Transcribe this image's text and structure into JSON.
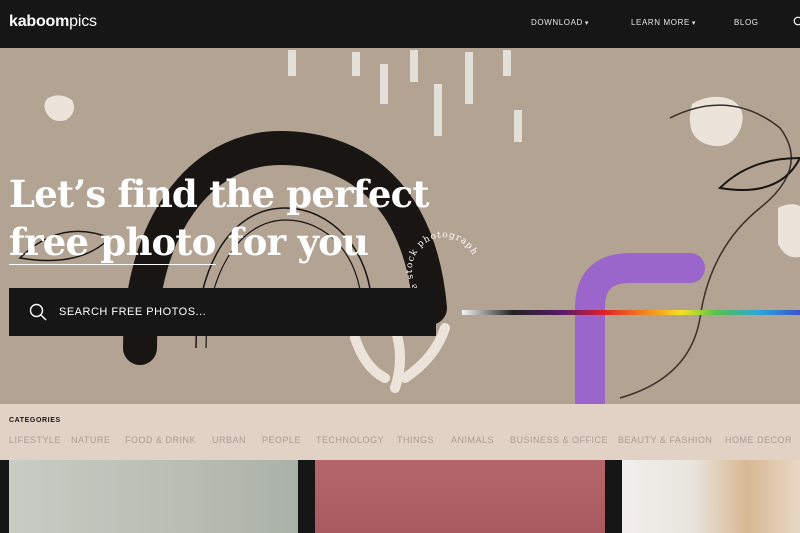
{
  "header": {
    "logo_bold": "kaboom",
    "logo_light": "pics",
    "nav": [
      {
        "label": "DOWNLOAD",
        "has_caret": true
      },
      {
        "label": "LEARN MORE",
        "has_caret": true
      },
      {
        "label": "BLOG",
        "has_caret": false
      }
    ],
    "search_icon": "search-icon"
  },
  "hero": {
    "headline_line1": "Let’s find the perfect",
    "headline_underlined": "free photo",
    "headline_rest": " for you",
    "circular_text": "free stock photography",
    "search": {
      "placeholder": "SEARCH FREE PHOTOS..."
    }
  },
  "categories": {
    "title": "CATEGORIES",
    "items": [
      "LIFESTYLE",
      "NATURE",
      "FOOD & DRINK",
      "URBAN",
      "PEOPLE",
      "TECHNOLOGY",
      "THINGS",
      "ANIMALS",
      "BUSINESS & OFFICE",
      "BEAUTY & FASHION",
      "HOME DECOR"
    ]
  },
  "colors": {
    "topbar": "#161616",
    "hero_bg": "#b3a393",
    "categories_bg": "#e2d1c5",
    "purple_shape": "#9a66cc"
  }
}
